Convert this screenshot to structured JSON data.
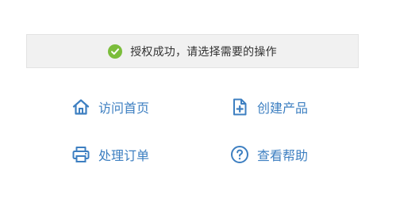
{
  "banner": {
    "message": "授权成功，请选择需要的操作",
    "icon": "check-circle-icon",
    "icon_color": "#7bbd3b"
  },
  "actions": [
    {
      "label": "访问首页",
      "icon": "home-icon"
    },
    {
      "label": "创建产品",
      "icon": "file-plus-icon"
    },
    {
      "label": "处理订单",
      "icon": "printer-icon"
    },
    {
      "label": "查看帮助",
      "icon": "help-circle-icon"
    }
  ],
  "colors": {
    "link": "#3d7fc1",
    "banner_bg": "#f1f1f1",
    "text": "#333333"
  }
}
